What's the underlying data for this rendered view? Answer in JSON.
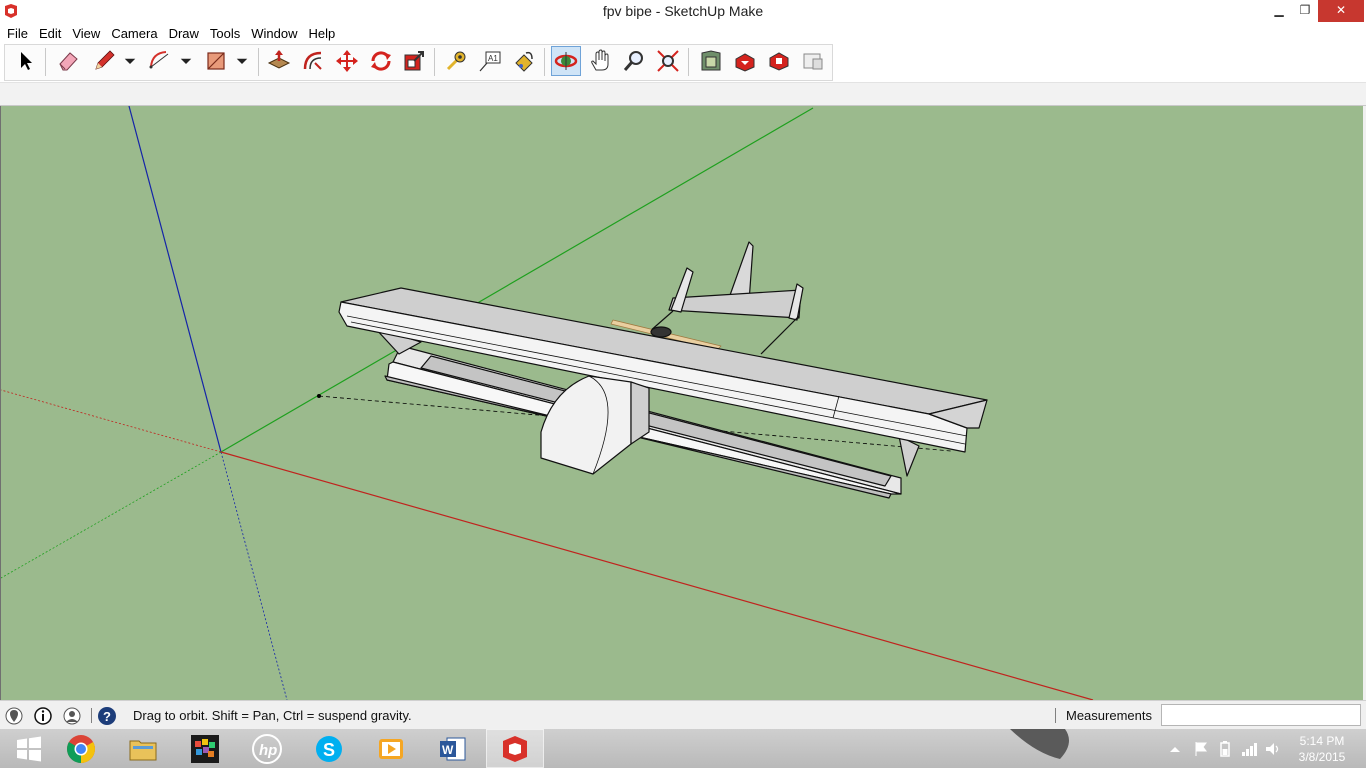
{
  "window": {
    "title": "fpv bipe - SketchUp Make",
    "minimize_glyph": "▁",
    "maximize_glyph": "❐",
    "close_glyph": "✕"
  },
  "menu": [
    "File",
    "Edit",
    "View",
    "Camera",
    "Draw",
    "Tools",
    "Window",
    "Help"
  ],
  "toolbar": {
    "tools": [
      {
        "name": "select-icon"
      },
      {
        "name": "eraser-icon"
      },
      {
        "name": "pencil-line-icon"
      },
      {
        "name": "arc-icon"
      },
      {
        "name": "rectangle-icon"
      },
      {
        "name": "push-pull-icon"
      },
      {
        "name": "offset-icon"
      },
      {
        "name": "move-icon"
      },
      {
        "name": "rotate-icon"
      },
      {
        "name": "scale-icon"
      },
      {
        "name": "tape-measure-icon"
      },
      {
        "name": "text-label-icon"
      },
      {
        "name": "paint-bucket-icon"
      },
      {
        "name": "orbit-icon",
        "active": true
      },
      {
        "name": "pan-hand-icon"
      },
      {
        "name": "zoom-icon"
      },
      {
        "name": "zoom-extents-icon"
      },
      {
        "name": "3d-warehouse-icon"
      },
      {
        "name": "share-model-icon"
      },
      {
        "name": "extension-warehouse-icon"
      },
      {
        "name": "layout-icon"
      }
    ]
  },
  "viewport": {
    "background": "#9bba8d",
    "axis_colors": {
      "red": "#c0231e",
      "green": "#1ea01e",
      "blue": "#1424a8"
    }
  },
  "status": {
    "hint": "Drag to orbit. Shift = Pan, Ctrl = suspend gravity.",
    "measurements_label": "Measurements",
    "measurements_value": ""
  },
  "taskbar": {
    "apps": [
      "start-icon",
      "chrome-icon",
      "file-explorer-icon",
      "app-grid-icon",
      "hp-icon",
      "skype-icon",
      "media-player-icon",
      "word-icon",
      "sketchup-icon"
    ],
    "clock_time": "5:14 PM",
    "clock_date": "3/8/2015"
  }
}
